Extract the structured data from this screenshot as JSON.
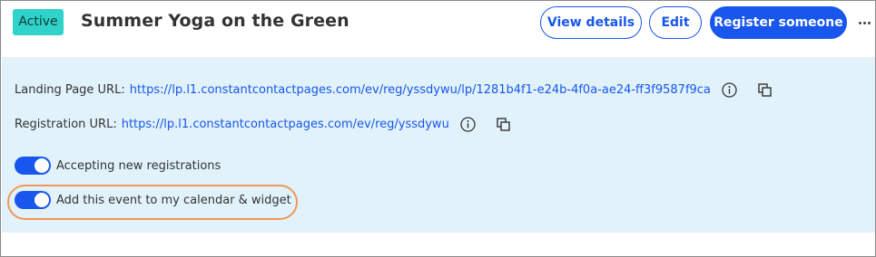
{
  "header": {
    "status": "Active",
    "title": "Summer Yoga on the Green",
    "view_details": "View details",
    "edit": "Edit",
    "register": "Register someone"
  },
  "links": {
    "landing_label": "Landing Page URL:",
    "landing_url": "https://lp.l1.constantcontactpages.com/ev/reg/yssdywu/lp/1281b4f1-e24b-4f0a-ae24-ff3f9587f9ca",
    "registration_label": "Registration URL:",
    "registration_url": "https://lp.l1.constantcontactpages.com/ev/reg/yssdywu"
  },
  "toggles": [
    {
      "label": "Accepting new registrations",
      "on": true
    },
    {
      "label": "Add this event to my calendar & widget",
      "on": true
    }
  ],
  "colors": {
    "accent": "#1856ed",
    "status_badge": "#2fd3c9",
    "panel_bg": "#e1f2fb",
    "highlight": "#f0975b"
  }
}
